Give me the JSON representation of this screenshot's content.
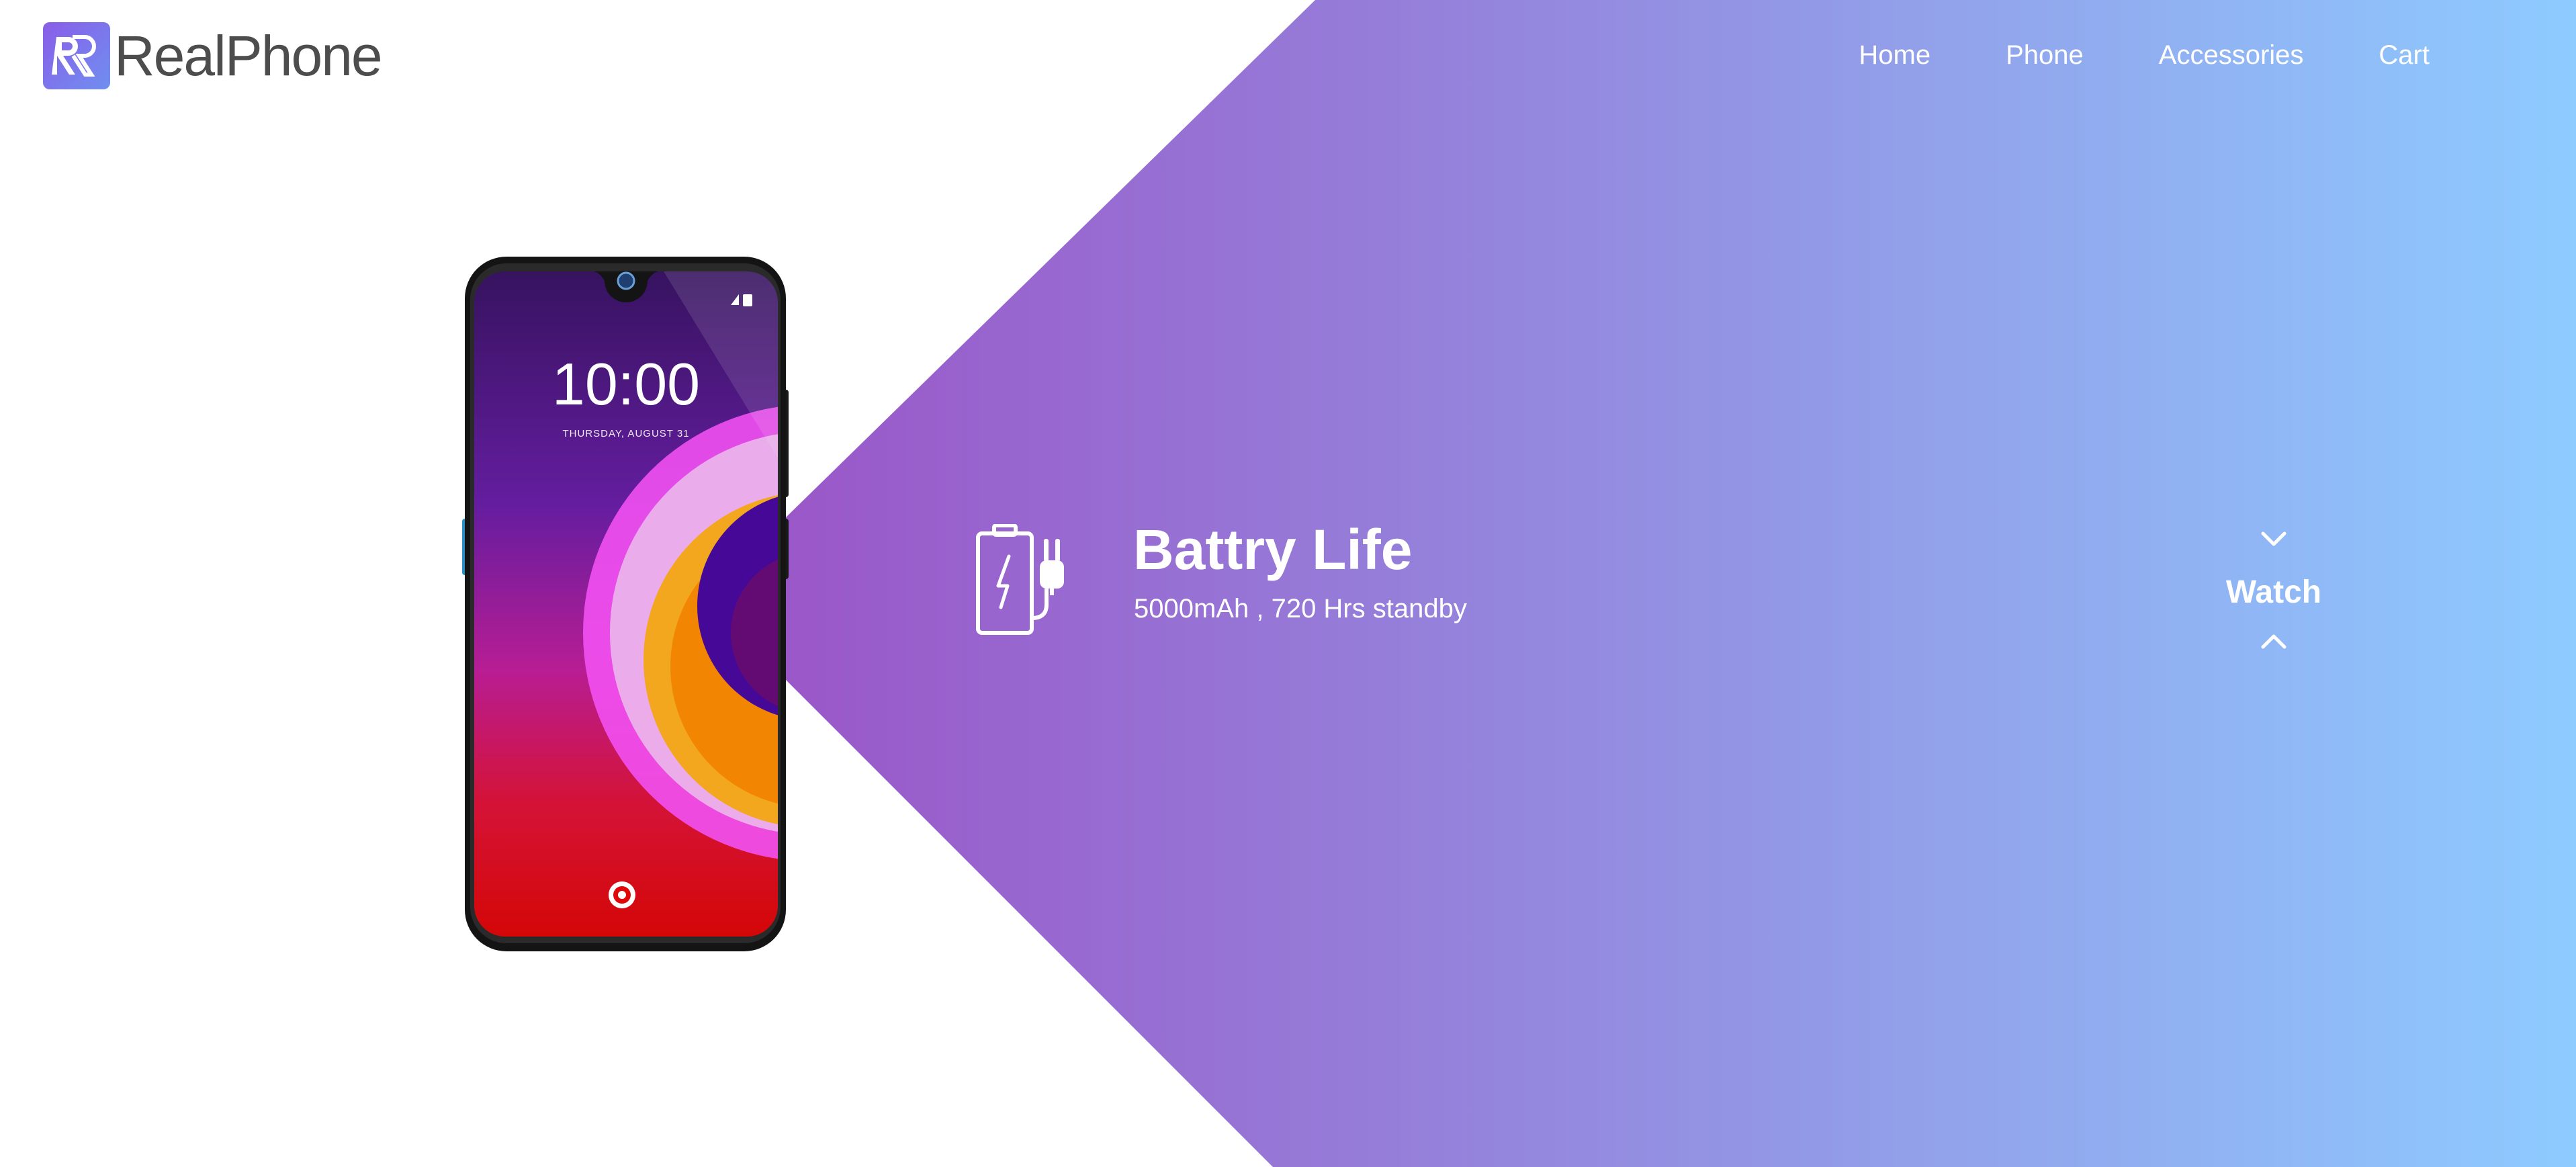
{
  "brand": {
    "name": "RealPhone",
    "logo_icon": "rr-monogram-icon"
  },
  "nav": {
    "items": [
      {
        "label": "Home"
      },
      {
        "label": "Phone"
      },
      {
        "label": "Accessories"
      },
      {
        "label": "Cart"
      }
    ]
  },
  "hero": {
    "phone_screen": {
      "time": "10:00",
      "date": "THURSDAY, AUGUST 31"
    },
    "feature": {
      "icon": "battery-charging-icon",
      "title": "Battry Life",
      "subtitle": "5000mAh , 720 Hrs standby"
    },
    "control": {
      "label": "Watch",
      "prev_icon": "chevron-down-icon",
      "next_icon": "chevron-up-icon"
    }
  },
  "colors": {
    "gradient_start": "#9a56c8",
    "gradient_mid": "#9488de",
    "gradient_end": "#8ecbff",
    "logo_text": "#4d4d4d"
  }
}
